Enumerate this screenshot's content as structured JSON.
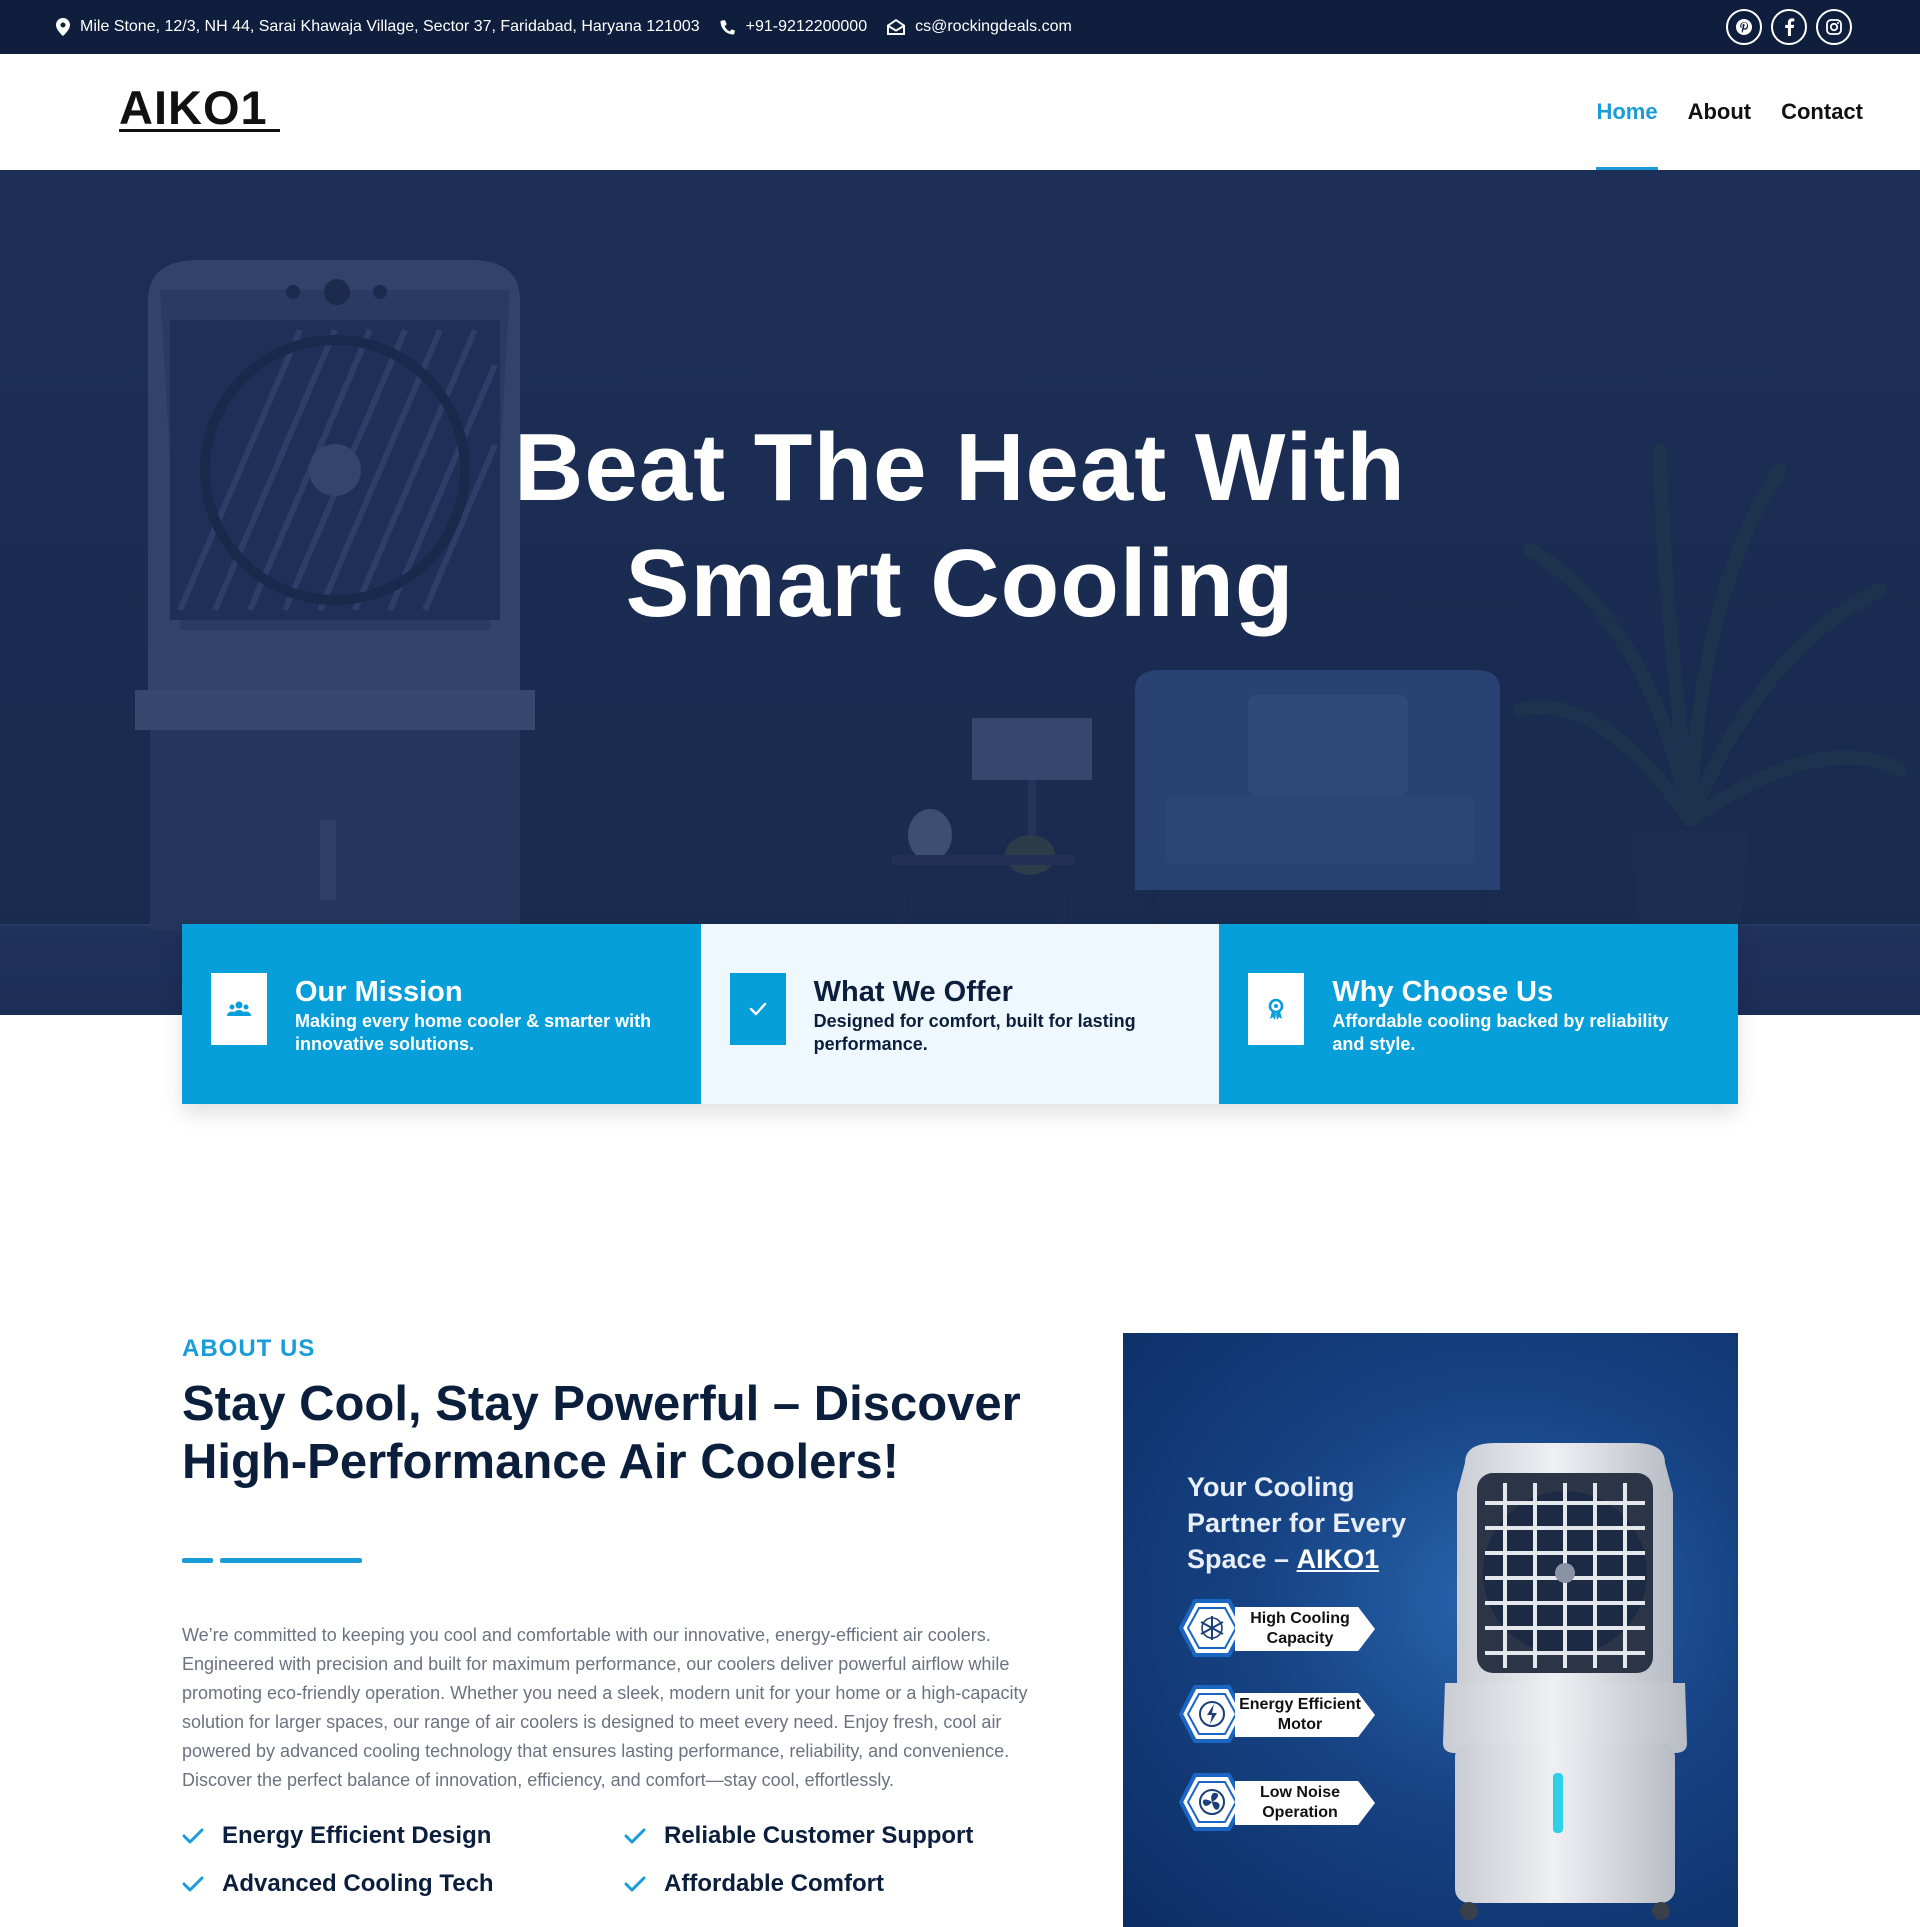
{
  "topbar": {
    "address": "Mile Stone, 12/3, NH 44, Sarai Khawaja Village, Sector 37, Faridabad, Haryana 121003",
    "phone": "+91-9212200000",
    "email": "cs@rockingdeals.com",
    "socials": [
      "pinterest-icon",
      "facebook-icon",
      "instagram-icon"
    ]
  },
  "header": {
    "logo": "AIKO1",
    "nav": [
      {
        "label": "Home",
        "active": true
      },
      {
        "label": "About",
        "active": false
      },
      {
        "label": "Contact",
        "active": false
      }
    ]
  },
  "hero": {
    "title_line1": "Beat The Heat With",
    "title_line2": "Smart Cooling"
  },
  "features": [
    {
      "icon": "users-icon",
      "title": "Our Mission",
      "text": "Making every home cooler & smarter with innovative solutions."
    },
    {
      "icon": "check-icon",
      "title": "What We Offer",
      "text": "Designed for comfort, built for lasting performance."
    },
    {
      "icon": "award-icon",
      "title": "Why Choose Us",
      "text": "Affordable cooling backed by reliability and style."
    }
  ],
  "about": {
    "kicker": "ABOUT US",
    "title": "Stay Cool, Stay Powerful – Discover High-Performance Air Coolers!",
    "text": "We’re committed to keeping you cool and comfortable with our innovative, energy-efficient air coolers. Engineered with precision and built for maximum performance, our coolers deliver powerful airflow while promoting eco-friendly operation. Whether you need a sleek, modern unit for your home or a high-capacity solution for larger spaces, our range of air coolers is designed to meet every need. Enjoy fresh, cool air powered by advanced cooling technology that ensures lasting performance, reliability, and convenience. Discover the perfect balance of innovation, efficiency, and comfort—stay cool, effortlessly.",
    "checks": [
      "Energy Efficient Design",
      "Reliable Customer Support",
      "Advanced Cooling Tech",
      "Affordable Comfort"
    ]
  },
  "promo": {
    "title": "Your Cooling Partner for Every Space –",
    "brand": "AIKO1",
    "features": [
      "High Cooling Capacity",
      "Energy Efficient Motor",
      "Low Noise Operation"
    ]
  },
  "colors": {
    "accent": "#1a9cd8",
    "topbar": "#0f1e3c",
    "feature_blue": "#079fd9",
    "feature_light": "#eef8fe",
    "heading": "#0b1f3d"
  }
}
